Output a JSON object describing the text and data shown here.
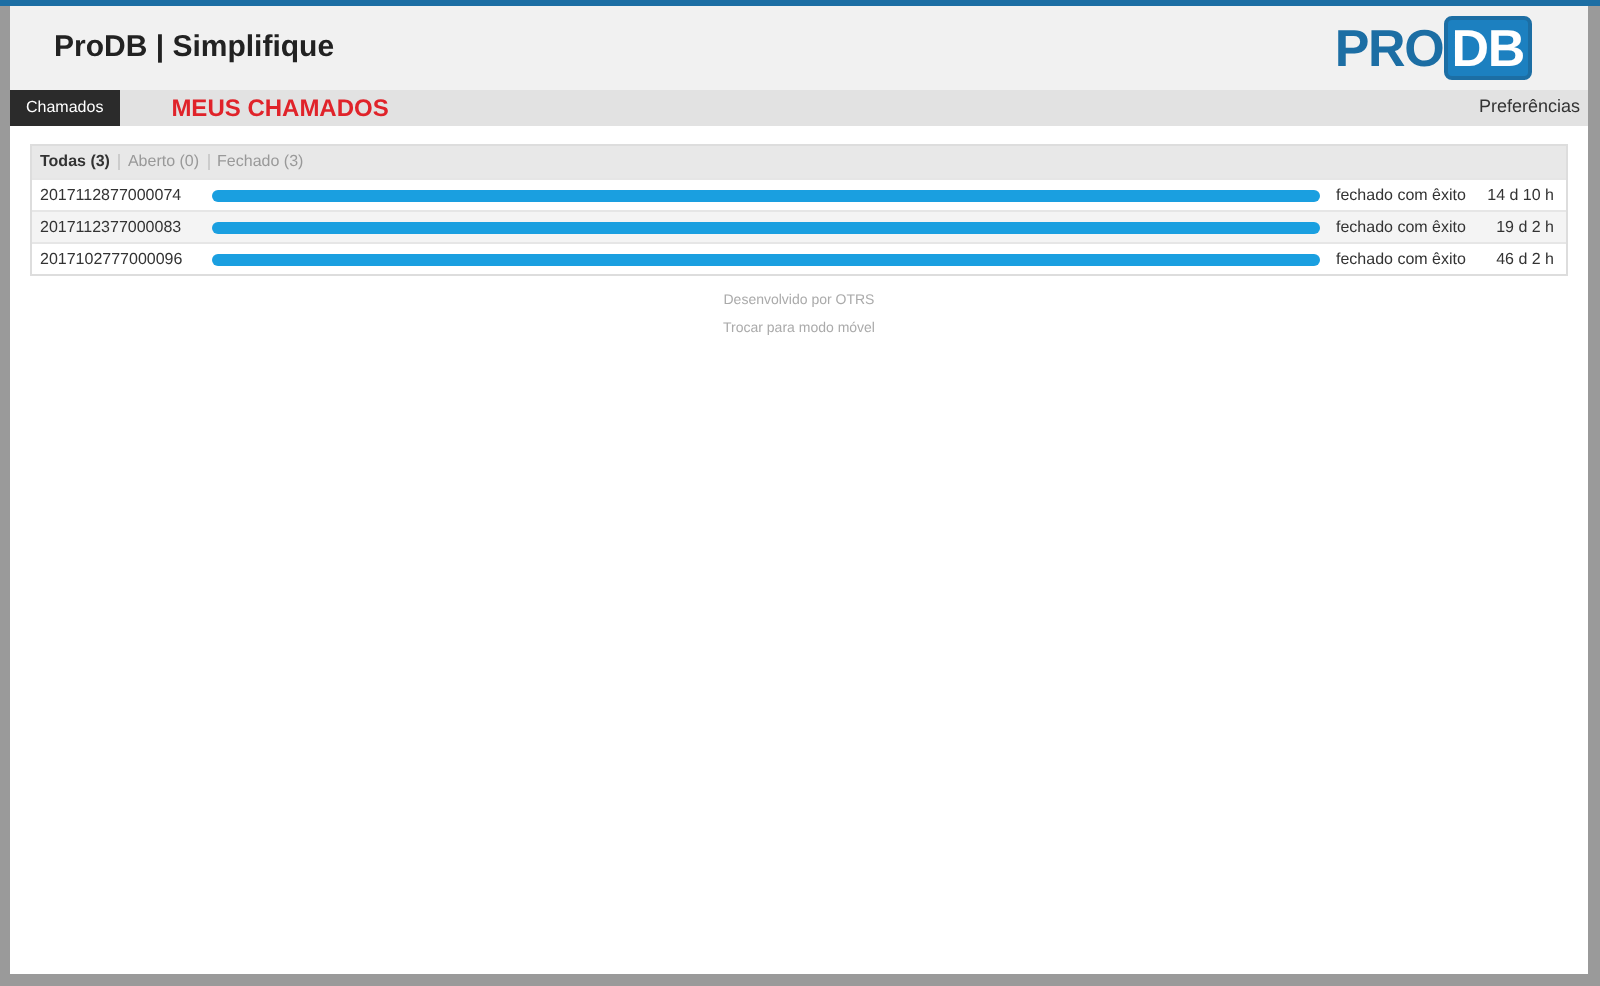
{
  "header": {
    "title": "ProDB | Simplifique",
    "logo": [
      "PRO",
      "DB"
    ]
  },
  "nav": {
    "items": [
      {
        "label": "Chamados",
        "selected": true
      }
    ],
    "page_heading": "MEUS CHAMADOS",
    "preferences": "Preferências"
  },
  "filters": [
    {
      "label": "Todas (3)",
      "selected": true
    },
    {
      "label": "Aberto (0)",
      "selected": false
    },
    {
      "label": "Fechado (3)",
      "selected": false
    }
  ],
  "tickets": [
    {
      "number": "2017112877000074",
      "state": "fechado com êxito",
      "age": "14 d 10 h"
    },
    {
      "number": "2017112377000083",
      "state": "fechado com êxito",
      "age": "19 d 2 h"
    },
    {
      "number": "2017102777000096",
      "state": "fechado com êxito",
      "age": "46 d 2 h"
    }
  ],
  "footer": [
    "Desenvolvido por OTRS",
    "Trocar para modo móvel"
  ]
}
